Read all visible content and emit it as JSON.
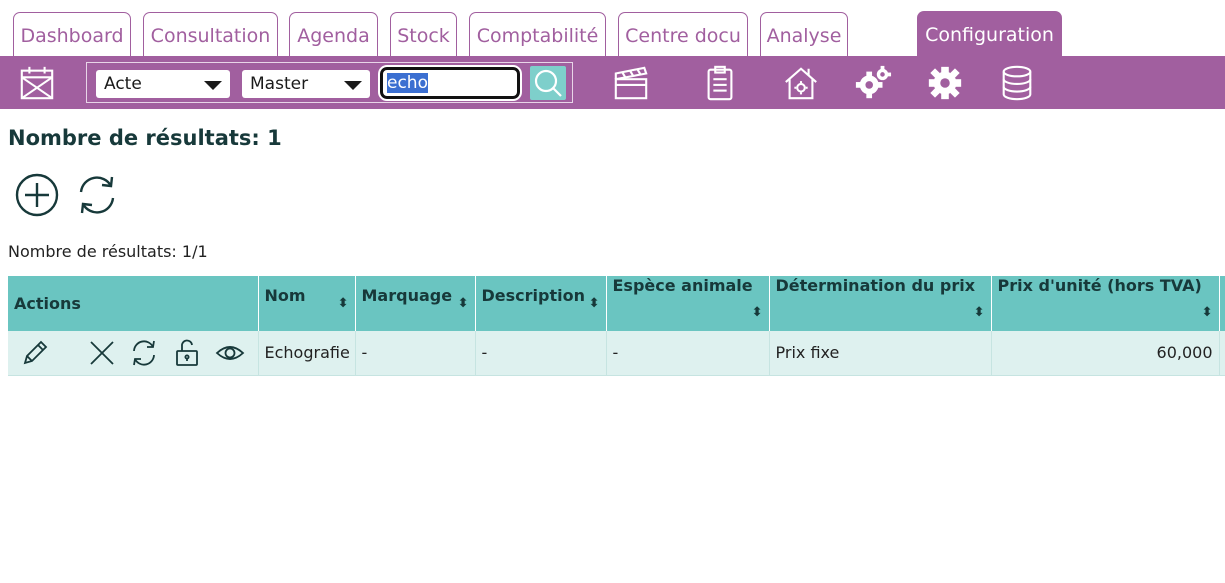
{
  "tabs": [
    {
      "label": "Dashboard",
      "active": false
    },
    {
      "label": "Consultation",
      "active": false
    },
    {
      "label": "Agenda",
      "active": false
    },
    {
      "label": "Stock",
      "active": false
    },
    {
      "label": "Comptabilité",
      "active": false
    },
    {
      "label": "Centre docu",
      "active": false
    },
    {
      "label": "Analyse",
      "active": false
    },
    {
      "label": "Configuration",
      "active": true
    }
  ],
  "toolbar": {
    "type_select": "Acte",
    "scope_select": "Master",
    "search_value": "echo",
    "icons": [
      "calendar-icon",
      "search-icon",
      "clapperboard-icon",
      "clipboard-icon",
      "clinic-settings-icon",
      "gears-icon",
      "gear-icon",
      "database-icon"
    ]
  },
  "main": {
    "title": "Nombre de résultats: 1",
    "count_text": "Nombre de résultats: 1/1"
  },
  "table": {
    "columns": [
      "Actions",
      "Nom",
      "Marquage",
      "Description",
      "Espèce animale",
      "Détermination du prix",
      "Prix d'unité (hors TVA)"
    ],
    "rows": [
      {
        "nom": "Echografie",
        "marquage": "-",
        "description": "-",
        "espece": "-",
        "determination": "Prix fixe",
        "prix": "60,000"
      }
    ]
  },
  "colors": {
    "accent": "#a15f9f",
    "table_header": "#6ac5c1",
    "row_bg": "#def1ef",
    "search_button": "#7ecfcb"
  }
}
